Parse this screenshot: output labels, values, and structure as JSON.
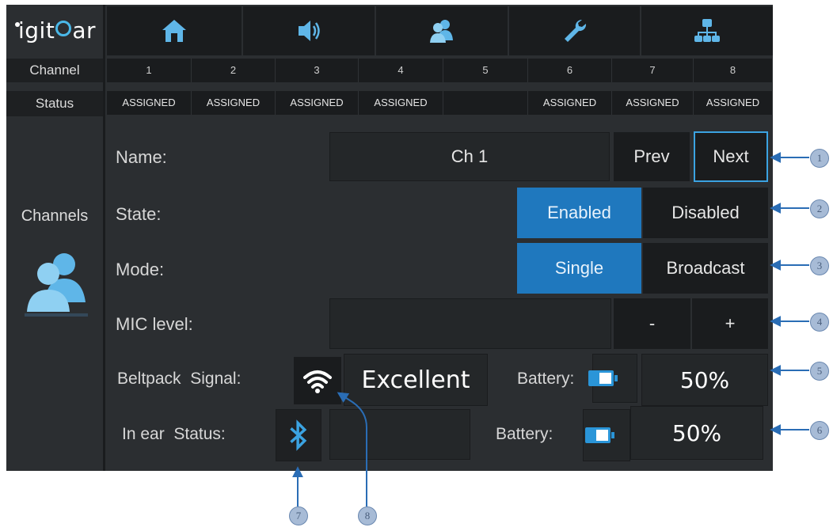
{
  "app": {
    "logo_text_1": "igit",
    "logo_text_2": "ar"
  },
  "nav": {
    "icons": [
      "home-icon",
      "speaker-icon",
      "users-icon",
      "wrench-icon",
      "network-icon"
    ]
  },
  "sidebar": {
    "channel_label": "Channel",
    "status_label": "Status",
    "section_label": "Channels",
    "section_icon": "users-icon"
  },
  "channels": {
    "numbers": [
      "1",
      "2",
      "3",
      "4",
      "5",
      "6",
      "7",
      "8"
    ],
    "statuses": [
      "ASSIGNED",
      "ASSIGNED",
      "ASSIGNED",
      "ASSIGNED",
      "",
      "ASSIGNED",
      "ASSIGNED",
      "ASSIGNED"
    ]
  },
  "form": {
    "name_label": "Name:",
    "name_value": "Ch 1",
    "prev_label": "Prev",
    "next_label": "Next",
    "state_label": "State:",
    "enabled_label": "Enabled",
    "disabled_label": "Disabled",
    "mode_label": "Mode:",
    "single_label": "Single",
    "broadcast_label": "Broadcast",
    "mic_label": "MIC level:",
    "minus_label": "-",
    "plus_label": "+",
    "beltpack_label": "Beltpack  Signal:",
    "signal_value": "Excellent",
    "battery_label_1": "Battery:",
    "battery_value_1": "50%",
    "inear_label": "In ear  Status:",
    "battery_label_2": "Battery:",
    "battery_value_2": "50%"
  },
  "callouts": [
    "1",
    "2",
    "3",
    "4",
    "5",
    "6",
    "7",
    "8"
  ],
  "colors": {
    "accent": "#1f78be",
    "panel": "#2b2e31",
    "button": "#1a1c1e",
    "callout_line": "#2a6db5"
  }
}
